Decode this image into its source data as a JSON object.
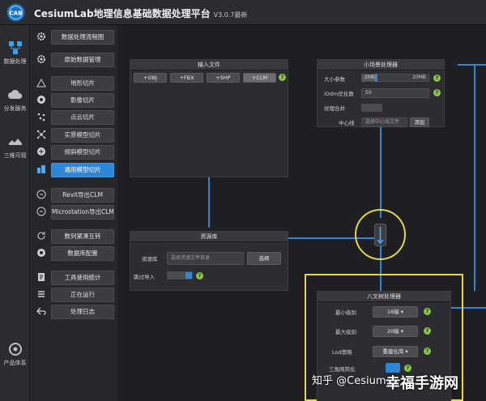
{
  "app": {
    "logo_text": "CAB",
    "title": "CesiumLab地理信息基础数据处理平台",
    "version": "V3.0.7最新"
  },
  "rail": [
    {
      "label": "数据处理",
      "icon": "data-process-icon"
    },
    {
      "label": "分发服务",
      "icon": "cloud-service-icon"
    },
    {
      "label": "三维可视",
      "icon": "3d-view-icon"
    },
    {
      "label": "产品体系",
      "icon": "product-icon"
    }
  ],
  "menu": [
    {
      "label": "数据处理流程图",
      "active": false
    },
    {
      "label": "原始数据管理",
      "active": false
    },
    {
      "label": "地形切片",
      "active": false
    },
    {
      "label": "影像切片",
      "active": false
    },
    {
      "label": "点云切片",
      "active": false
    },
    {
      "label": "实景模型切片",
      "active": false
    },
    {
      "label": "倾斜模型切片",
      "active": false
    },
    {
      "label": "通用模型切片",
      "active": true
    },
    {
      "label": "Revit导出CLM",
      "active": false
    },
    {
      "label": "Microstation导出CLM",
      "active": false
    },
    {
      "label": "数列紧凑互转",
      "active": false
    },
    {
      "label": "数据库配置",
      "active": false
    },
    {
      "label": "工具使用统计",
      "active": false
    },
    {
      "label": "正在运行",
      "active": false
    },
    {
      "label": "处理日志",
      "active": false
    }
  ],
  "input_panel": {
    "title": "输入文件",
    "buttons": [
      "+OBJ",
      "+FBX",
      "+SHP",
      "+CLM"
    ],
    "help": "?"
  },
  "small_scene_panel": {
    "title": "小场景处理器",
    "size_label": "大小参数",
    "size_min": "2MB",
    "size_max": "20MB",
    "idx_label": "iOdm优化数",
    "idx_value": "50",
    "merge_label": "纹理合并",
    "center_label": "中心线",
    "center_placeholder": "选择中心线文件",
    "center_button": "添加",
    "help": "?"
  },
  "repo_panel": {
    "title": "资源库",
    "repo_label": "资源库",
    "repo_placeholder": "选择资源文件目录",
    "repo_button": "选择",
    "skip_label": "跳过导入",
    "help": "?"
  },
  "octree_panel": {
    "title": "八叉树处理器",
    "min_label": "最小级别",
    "min_value": "16级",
    "max_label": "最大级别",
    "max_value": "20级",
    "lod_label": "Lod策略",
    "lod_value": "重建化简",
    "tri_label": "三角网简化",
    "help": "?"
  },
  "watermark": "知乎 @Cesium...",
  "brand": "幸福手游网",
  "colors": {
    "accent": "#2f86d6",
    "highlight": "#e8d64a",
    "help": "#8bc34a"
  }
}
